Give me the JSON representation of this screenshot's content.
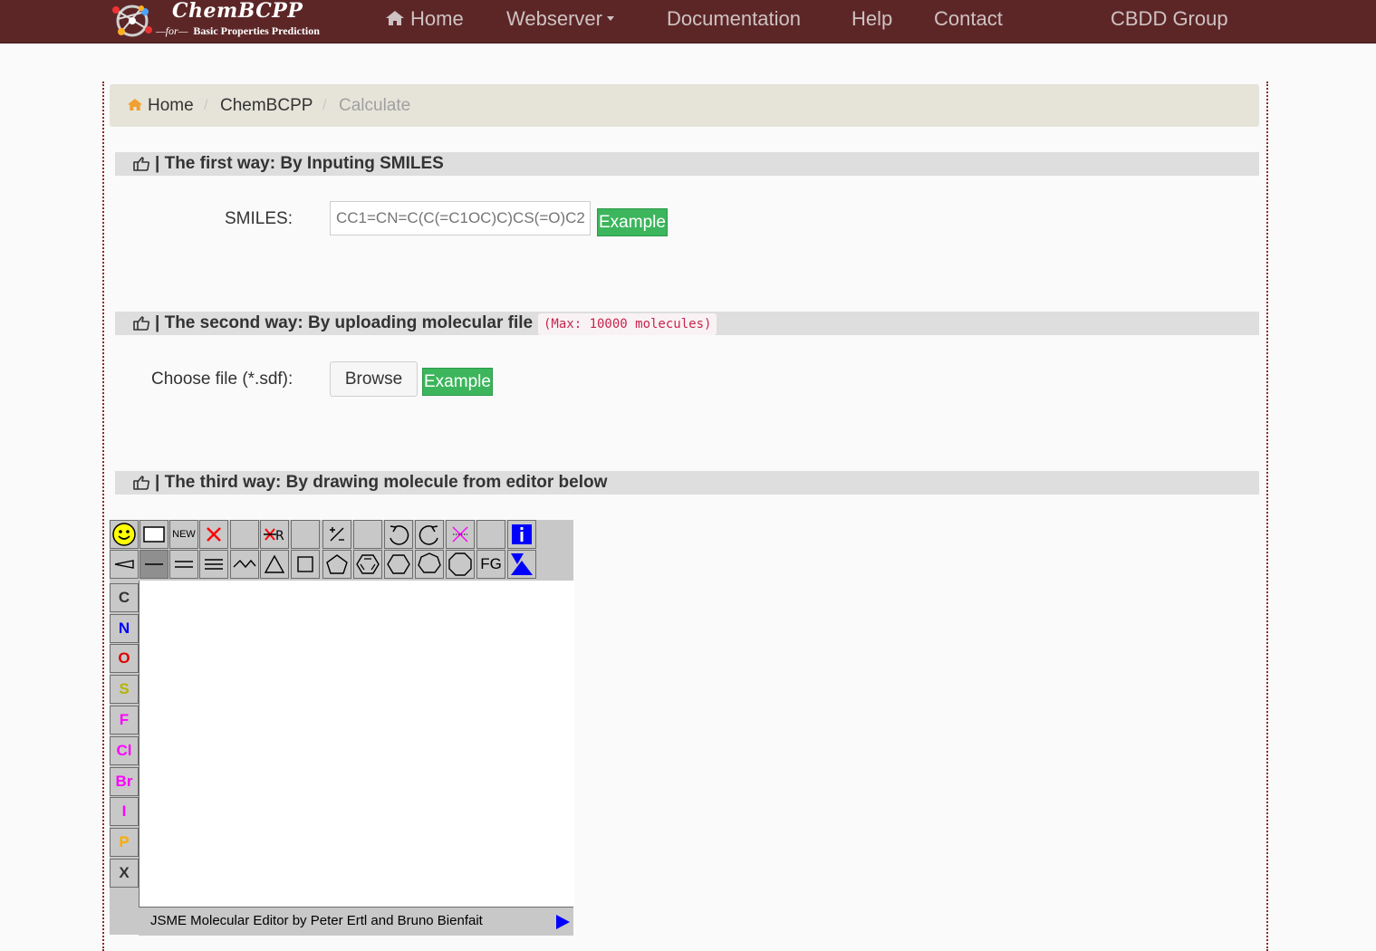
{
  "navbar": {
    "logo_name": "ChemBCPP",
    "logo_for": "—for—",
    "logo_sub": "Basic Properties Prediction",
    "home": "Home",
    "webserver": "Webserver",
    "documentation": "Documentation",
    "help": "Help",
    "contact": "Contact",
    "group": "CBDD Group"
  },
  "breadcrumb": {
    "home": "Home",
    "sep": "/",
    "chembcpp": "ChemBCPP",
    "current": "Calculate"
  },
  "section1": {
    "title": "| The first way: By Inputing SMILES",
    "smiles_label": "SMILES:",
    "smiles_value": "CC1=CN=C(C(=C1OC)C)CS(=O)C2",
    "example": "Example"
  },
  "section2": {
    "title": "| The second way: By uploading molecular file",
    "max_note": "(Max: 10000 molecules)",
    "file_label": "Choose file (*.sdf):",
    "browse": "Browse",
    "example": "Example"
  },
  "section3": {
    "title": "| The third way: By drawing molecule from editor below"
  },
  "jsme": {
    "new_label": "NEW",
    "fg_label": "FG",
    "atoms": [
      {
        "symbol": "C",
        "color": "#333333"
      },
      {
        "symbol": "N",
        "color": "#0000ff"
      },
      {
        "symbol": "O",
        "color": "#e00000"
      },
      {
        "symbol": "S",
        "color": "#b4b400"
      },
      {
        "symbol": "F",
        "color": "#ff00ff"
      },
      {
        "symbol": "Cl",
        "color": "#ff00ff"
      },
      {
        "symbol": "Br",
        "color": "#ff00ff"
      },
      {
        "symbol": "I",
        "color": "#ff00ff"
      },
      {
        "symbol": "P",
        "color": "#ffaa00"
      },
      {
        "symbol": "X",
        "color": "#333333"
      }
    ],
    "status": "JSME Molecular Editor by Peter Ertl and Bruno Bienfait"
  },
  "colors": {
    "navbar_bg": "#5c2627",
    "example_btn": "#3cb55c",
    "home_icon": "#f0a030"
  }
}
